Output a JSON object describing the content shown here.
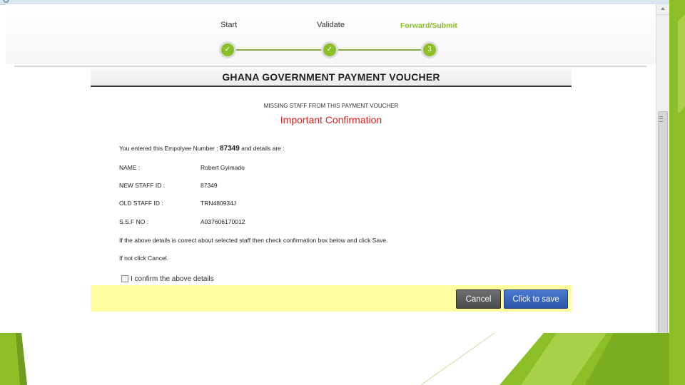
{
  "wizard": {
    "steps": [
      {
        "label": "Start",
        "marker": "✓"
      },
      {
        "label": "Validate",
        "marker": "✓"
      },
      {
        "label": "Forward/Submit",
        "marker": "3"
      }
    ]
  },
  "voucher": {
    "title": "GHANA GOVERNMENT PAYMENT VOUCHER",
    "subtitle": "MISSING STAFF FROM THIS PAYMENT VOUCHER",
    "heading": "Important Confirmation",
    "entered_prefix": "You entered this Empolyee Number : ",
    "employee_number": "87349",
    "entered_suffix": " and details are :",
    "details": [
      {
        "label": "NAME :",
        "value": "Robert Gyimado"
      },
      {
        "label": "NEW STAFF ID :",
        "value": "87349"
      },
      {
        "label": "OLD STAFF ID :",
        "value": "TRN480934J"
      },
      {
        "label": "S.S.F NO :",
        "value": "A037606170012"
      }
    ],
    "instruction": "If the above details is correct about selected staff then check confirmation box below and click Save.",
    "if_not": "If not click Cancel.",
    "confirm_label": "I confirm the above details",
    "cancel_label": "Cancel",
    "save_label": "Click to save"
  },
  "colors": {
    "accent_green": "#8cbf26",
    "alert_red": "#e02020",
    "footer_yellow": "#ffffa0",
    "save_blue": "#2b55a8"
  }
}
